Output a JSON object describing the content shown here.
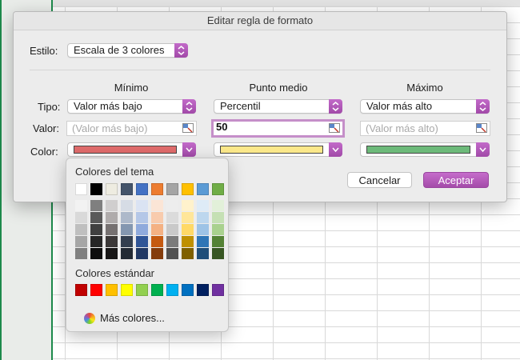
{
  "dialog": {
    "title": "Editar regla de formato",
    "style_label": "Estilo:",
    "style_value": "Escala de 3 colores",
    "columns": [
      "Mínimo",
      "Punto medio",
      "Máximo"
    ],
    "row_labels": {
      "type": "Tipo:",
      "value": "Valor:",
      "color": "Color:"
    },
    "min": {
      "type": "Valor más bajo",
      "value_placeholder": "(Valor más bajo)",
      "color": "#e06c6c"
    },
    "mid": {
      "type": "Percentil",
      "value": "50",
      "color": "#fbe88a"
    },
    "max": {
      "type": "Valor más alto",
      "value_placeholder": "(Valor más alto)",
      "color": "#6dba7a"
    },
    "cancel_label": "Cancelar",
    "accept_label": "Aceptar"
  },
  "color_popover": {
    "theme_title": "Colores del tema",
    "standard_title": "Colores estándar",
    "more_label": "Más colores...",
    "theme_colors": [
      "#ffffff",
      "#000000",
      "#eeece1",
      "#44546a",
      "#4472c4",
      "#ed7d31",
      "#a5a5a5",
      "#ffc000",
      "#5b9bd5",
      "#70ad47"
    ],
    "shades": [
      [
        "#f2f2f2",
        "#d9d9d9",
        "#bfbfbf",
        "#a6a6a6",
        "#808080"
      ],
      [
        "#7f7f7f",
        "#595959",
        "#404040",
        "#262626",
        "#0d0d0d"
      ],
      [
        "#d0cece",
        "#afabab",
        "#767171",
        "#3b3838",
        "#171616"
      ],
      [
        "#d6dce5",
        "#adb9ca",
        "#8497b0",
        "#333f50",
        "#222a35"
      ],
      [
        "#dae3f3",
        "#b4c7e7",
        "#8faadc",
        "#2f5597",
        "#203864"
      ],
      [
        "#fbe5d6",
        "#f8cbad",
        "#f4b183",
        "#c55a11",
        "#843c0c"
      ],
      [
        "#ededed",
        "#dbdbdb",
        "#c9c9c9",
        "#7b7b7b",
        "#525252"
      ],
      [
        "#fff2cc",
        "#ffe699",
        "#ffd966",
        "#bf9000",
        "#7f6000"
      ],
      [
        "#deebf7",
        "#bdd7ee",
        "#9dc3e6",
        "#2e75b6",
        "#1f4e79"
      ],
      [
        "#e2f0d9",
        "#c5e0b4",
        "#a9d18e",
        "#548235",
        "#385723"
      ]
    ],
    "standard_colors": [
      "#c00000",
      "#ff0000",
      "#ffc000",
      "#ffff00",
      "#92d050",
      "#00b050",
      "#00b0f0",
      "#0070c0",
      "#002060",
      "#7030a0"
    ]
  }
}
